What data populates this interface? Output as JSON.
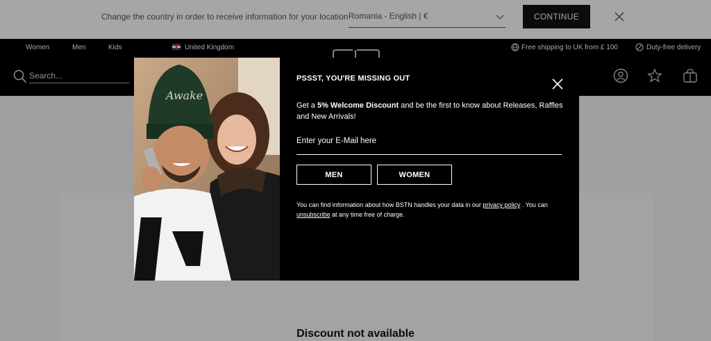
{
  "country_bar": {
    "message": "Change the country in order to receive information for your location",
    "selected_country": "Romania - English | €",
    "continue_label": "CONTINUE"
  },
  "top_nav": {
    "links": [
      "Women",
      "Men",
      "Kids"
    ],
    "region": "United Kingdom",
    "shipping": "Free shipping to UK from £ 100",
    "duty": "Duty-free delivery"
  },
  "header": {
    "search_placeholder": "Search..."
  },
  "page": {
    "heading": "Discount not available"
  },
  "modal": {
    "title": "PSSST, YOU'RE MISSING OUT",
    "desc_pre": "Get a ",
    "desc_bold": "5% Welcome Discount",
    "desc_post": " and be the first to know about Releases, Raffles and New Arrivals!",
    "email_placeholder": "Enter your E-Mail here",
    "men_label": "MEN",
    "women_label": "WOMEN",
    "privacy_pre": "You can find information about how BSTN handles your data in our ",
    "privacy_link": "privacy policy",
    "privacy_mid": " . You can ",
    "unsubscribe_link": "unsubscribe",
    "privacy_post": " at any time free of charge."
  }
}
